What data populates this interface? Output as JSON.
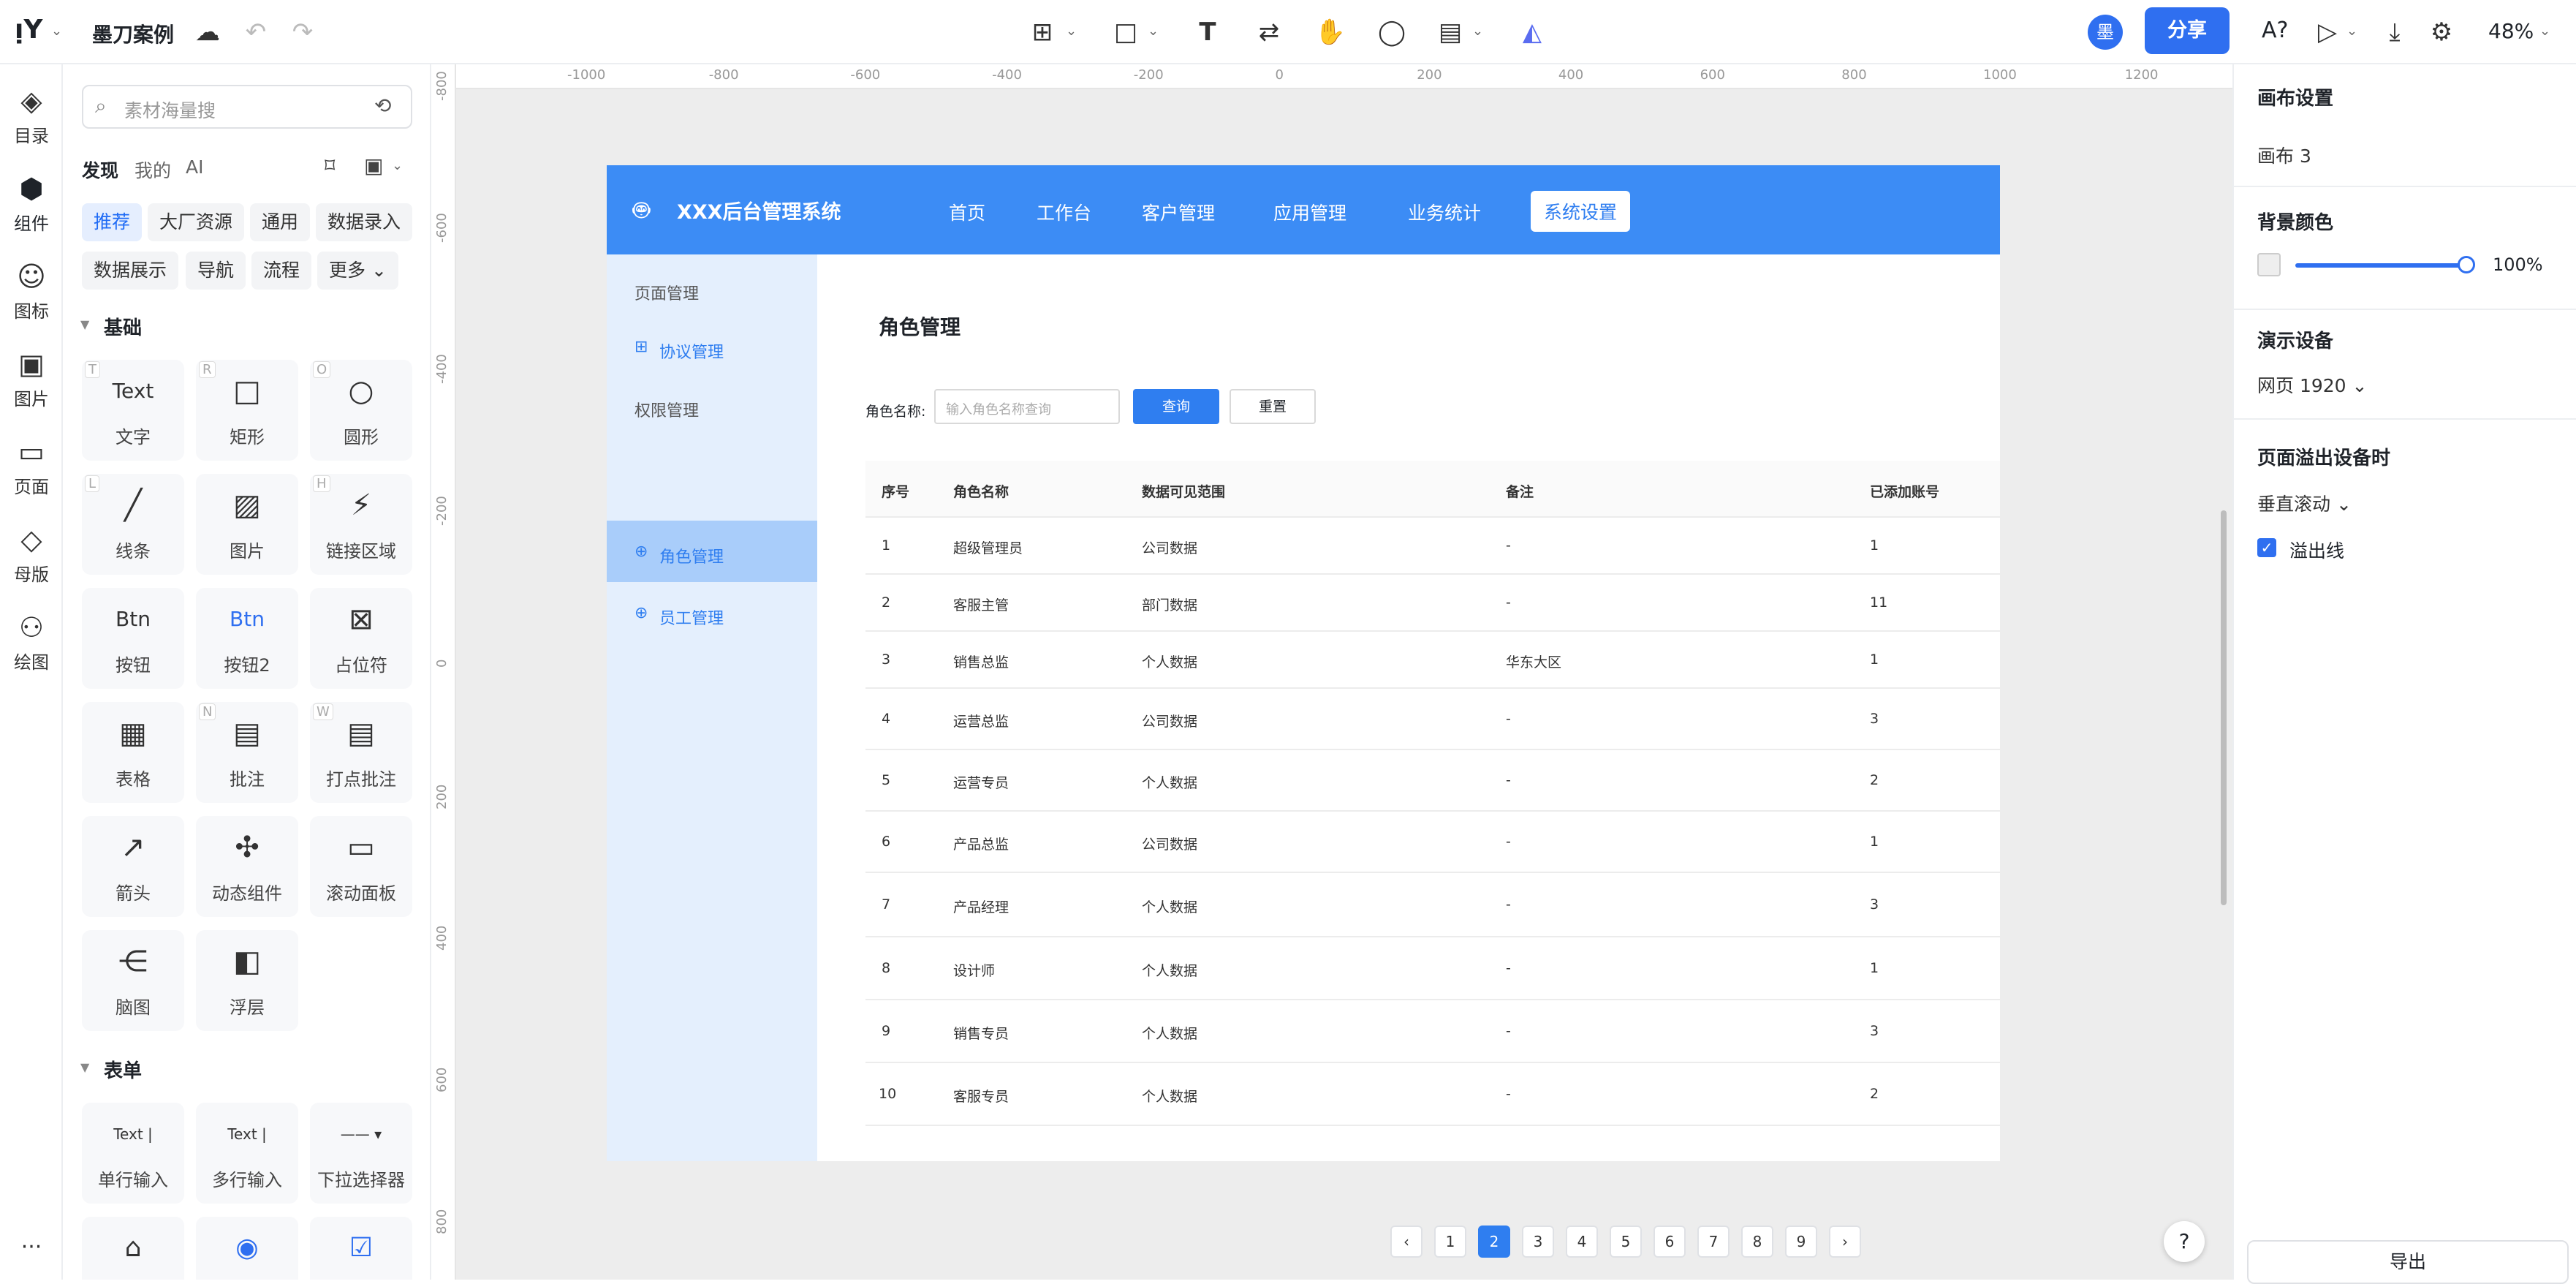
{
  "topbar": {
    "logo": "ᴉ𝗬",
    "title": "墨刀案例",
    "share": "分享",
    "avatar": "墨",
    "zoom": "48%",
    "font_icon": "A?"
  },
  "leftnav": [
    {
      "label": "目录",
      "icon": "◈"
    },
    {
      "label": "组件",
      "icon": "⬢"
    },
    {
      "label": "图标",
      "icon": "☺"
    },
    {
      "label": "图片",
      "icon": "▣"
    },
    {
      "label": "页面",
      "icon": "▭"
    },
    {
      "label": "母版",
      "icon": "◇"
    },
    {
      "label": "绘图",
      "icon": "⚇"
    }
  ],
  "more": "···",
  "panel": {
    "search_placeholder": "素材海量搜",
    "tabs": [
      "发现",
      "我的",
      "AI"
    ],
    "chips_row1": [
      "推荐",
      "大厂资源",
      "通用",
      "数据录入"
    ],
    "chips_row2": [
      "数据展示",
      "导航",
      "流程",
      "更多 ⌄"
    ],
    "section_basic": "基础",
    "section_form": "表单",
    "components": [
      {
        "label": "文字",
        "icon": "Text",
        "key": "T"
      },
      {
        "label": "矩形",
        "icon": "□",
        "key": "R"
      },
      {
        "label": "圆形",
        "icon": "○",
        "key": "O"
      },
      {
        "label": "线条",
        "icon": "╱",
        "key": "L"
      },
      {
        "label": "图片",
        "icon": "▨",
        "key": ""
      },
      {
        "label": "链接区域",
        "icon": "⚡",
        "key": "H"
      },
      {
        "label": "按钮",
        "icon": "Btn",
        "key": ""
      },
      {
        "label": "按钮2",
        "icon": "Btn",
        "key": ""
      },
      {
        "label": "占位符",
        "icon": "⊠",
        "key": ""
      },
      {
        "label": "表格",
        "icon": "▦",
        "key": ""
      },
      {
        "label": "批注",
        "icon": "▤",
        "key": "N"
      },
      {
        "label": "打点批注",
        "icon": "▤",
        "key": "W"
      },
      {
        "label": "箭头",
        "icon": "↗",
        "key": ""
      },
      {
        "label": "动态组件",
        "icon": "✣",
        "key": ""
      },
      {
        "label": "滚动面板",
        "icon": "▭",
        "key": ""
      },
      {
        "label": "脑图",
        "icon": "⋲",
        "key": ""
      },
      {
        "label": "浮层",
        "icon": "◧",
        "key": ""
      }
    ],
    "form_components": [
      {
        "label": "单行输入",
        "icon": "Text |"
      },
      {
        "label": "多行输入",
        "icon": "Text |"
      },
      {
        "label": "下拉选择器",
        "icon": "—— ▾"
      },
      {
        "label": "",
        "icon": "⌂"
      },
      {
        "label": "",
        "icon": "◉"
      },
      {
        "label": "",
        "icon": "☑"
      }
    ]
  },
  "ruler_x": [
    "-1000",
    "-800",
    "-600",
    "-400",
    "-200",
    "0",
    "200",
    "400",
    "600",
    "800",
    "1000",
    "1200"
  ],
  "ruler_y": [
    "-800",
    "-600",
    "-400",
    "-200",
    "0",
    "200",
    "400",
    "600",
    "800"
  ],
  "app": {
    "title": "XXX后台管理系统",
    "nav": [
      "首页",
      "工作台",
      "客户管理",
      "应用管理",
      "业务统计",
      "系统设置"
    ],
    "side": [
      {
        "label": "页面管理",
        "icon": ""
      },
      {
        "label": "协议管理",
        "icon": "⊞"
      },
      {
        "label": "权限管理",
        "icon": ""
      },
      {
        "label": "角色管理",
        "icon": "⊕"
      },
      {
        "label": "员工管理",
        "icon": "⊕"
      }
    ],
    "page_title": "角色管理",
    "filter_label": "角色名称:",
    "filter_placeholder": "输入角色名称查询",
    "query_btn": "查询",
    "reset_btn": "重置",
    "columns": [
      "序号",
      "角色名称",
      "数据可见范围",
      "备注",
      "已添加账号"
    ],
    "rows": [
      [
        "1",
        "超级管理员",
        "公司数据",
        "-",
        "1"
      ],
      [
        "2",
        "客服主管",
        "部门数据",
        "-",
        "11"
      ],
      [
        "3",
        "销售总监",
        "个人数据",
        "华东大区",
        "1"
      ],
      [
        "4",
        "运营总监",
        "公司数据",
        "-",
        "3"
      ],
      [
        "5",
        "运营专员",
        "个人数据",
        "-",
        "2"
      ],
      [
        "6",
        "产品总监",
        "公司数据",
        "-",
        "1"
      ],
      [
        "7",
        "产品经理",
        "个人数据",
        "-",
        "3"
      ],
      [
        "8",
        "设计师",
        "个人数据",
        "-",
        "1"
      ],
      [
        "9",
        "销售专员",
        "个人数据",
        "-",
        "3"
      ],
      [
        "10",
        "客服专员",
        "个人数据",
        "-",
        "2"
      ]
    ],
    "pages": [
      "‹",
      "1",
      "2",
      "3",
      "4",
      "5",
      "6",
      "7",
      "8",
      "9",
      "›"
    ]
  },
  "right": {
    "canvas_settings": "画布设置",
    "canvas_name": "画布 3",
    "bg_color": "背景颜色",
    "opacity": "100%",
    "device_title": "演示设备",
    "device": "网页 1920 ⌄",
    "overflow_title": "页面溢出设备时",
    "overflow": "垂直滚动 ⌄",
    "overflow_line": "溢出线",
    "export": "导出",
    "help": "?"
  }
}
